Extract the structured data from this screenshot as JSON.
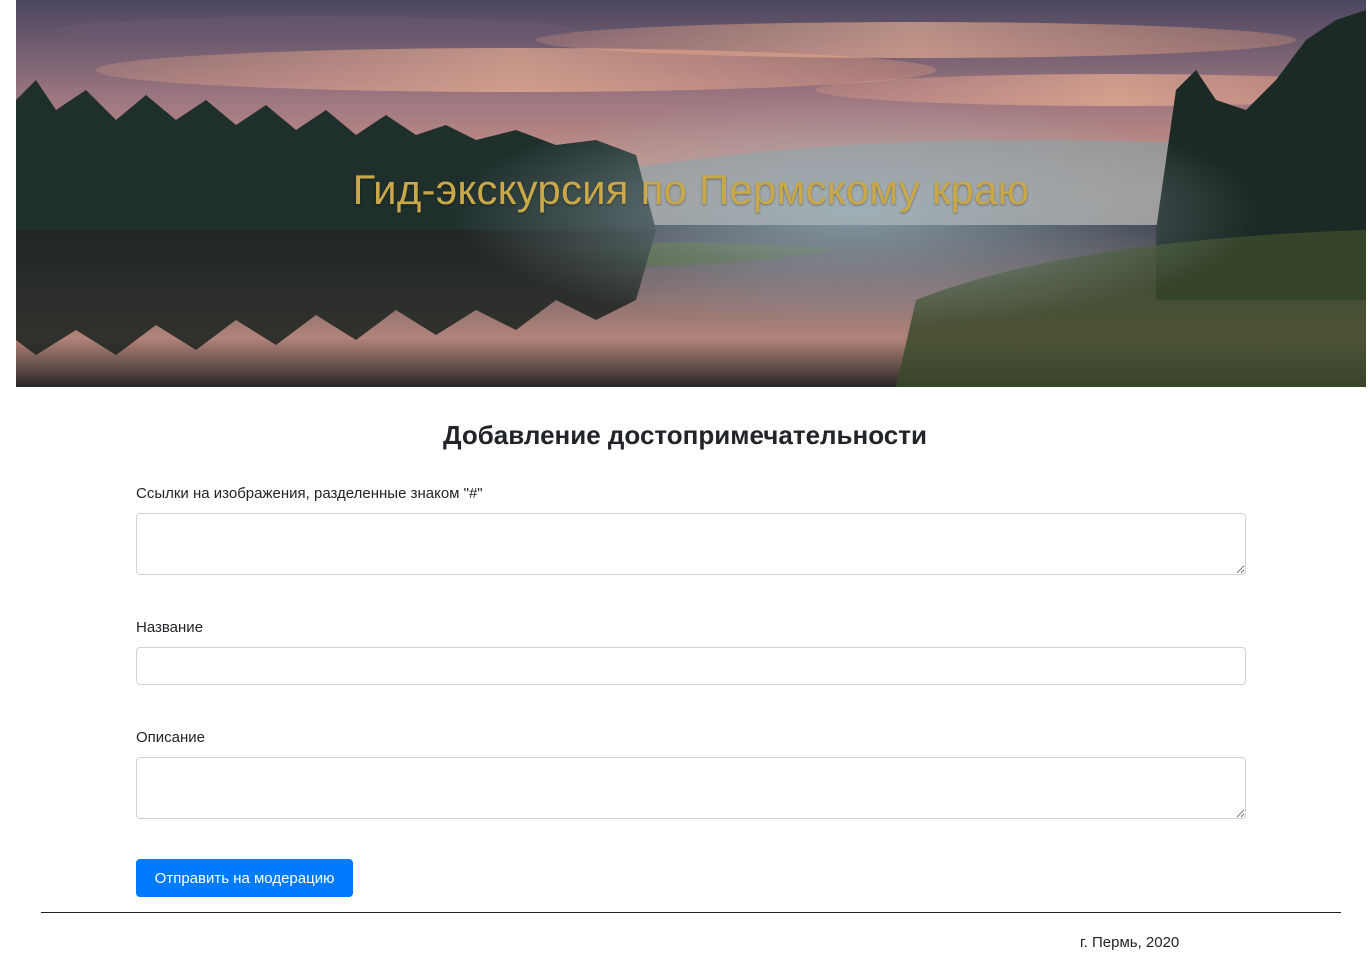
{
  "header": {
    "title": "Гид-экскурсия по Пермскому краю"
  },
  "form": {
    "heading": "Добавление достопримечательности",
    "images_label": "Ссылки на изображения, разделенные знаком \"#\"",
    "images_value": "",
    "name_label": "Название",
    "name_value": "",
    "description_label": "Описание",
    "description_value": "",
    "submit_label": "Отправить на модерацию"
  },
  "footer": {
    "text": "г. Пермь, 2020"
  },
  "colors": {
    "title_gold": "#c9a84a",
    "button_blue": "#007bff"
  }
}
